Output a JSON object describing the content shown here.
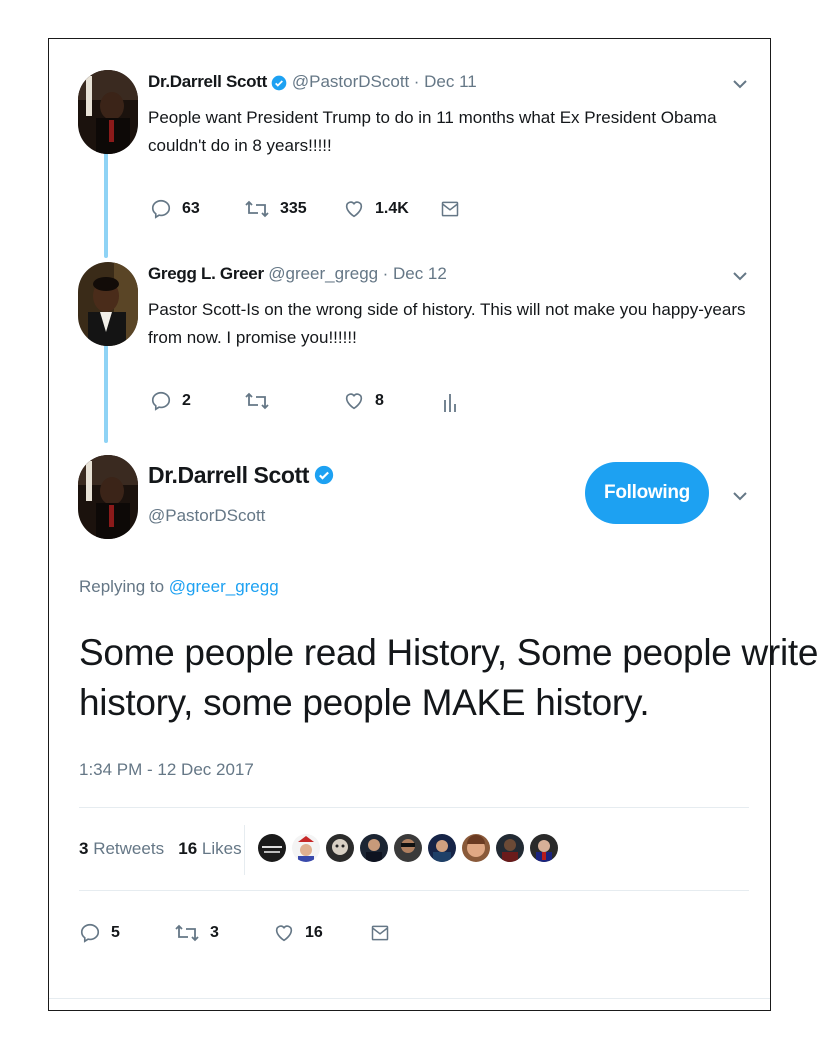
{
  "tweet1": {
    "name": "Dr.Darrell Scott",
    "handle": "@PastorDScott",
    "date": "· Dec 11",
    "text_line1": "People want President Trump to do in 11 months what Ex President Obama",
    "text_line2": "couldn't do in 8 years!!!!!",
    "replies": "63",
    "retweets": "335",
    "likes": "1.4K"
  },
  "tweet2": {
    "name": "Gregg L. Greer",
    "handle": "@greer_gregg",
    "date": "· Dec 12",
    "text_line1": "Pastor Scott-Is on the wrong side of history. This will not make you happy-years",
    "text_line2": "from now. I promise you!!!!!!",
    "replies": "2",
    "retweets": "",
    "likes": "8"
  },
  "main_tweet": {
    "name": "Dr.Darrell Scott",
    "handle": "@PastorDScott",
    "follow_label": "Following",
    "replying_prefix": "Replying to",
    "replying_handle": "@greer_gregg",
    "text_line1": "Some people read History, Some people write",
    "text_line2": "history, some people MAKE history.",
    "timestamp": "1:34 PM - 12 Dec 2017",
    "retweets_count": "3",
    "retweets_label": "Retweets",
    "likes_count": "16",
    "likes_label": "Likes",
    "replies": "5",
    "retweets": "3",
    "likes": "16"
  },
  "colors": {
    "accent": "#1da1f2",
    "thread_line": "#8fd3f5",
    "muted": "#657786",
    "text": "#14171a"
  },
  "icons": [
    "verified-badge-icon",
    "chevron-down-icon",
    "reply-icon",
    "retweet-icon",
    "like-icon",
    "message-icon",
    "analytics-icon"
  ]
}
